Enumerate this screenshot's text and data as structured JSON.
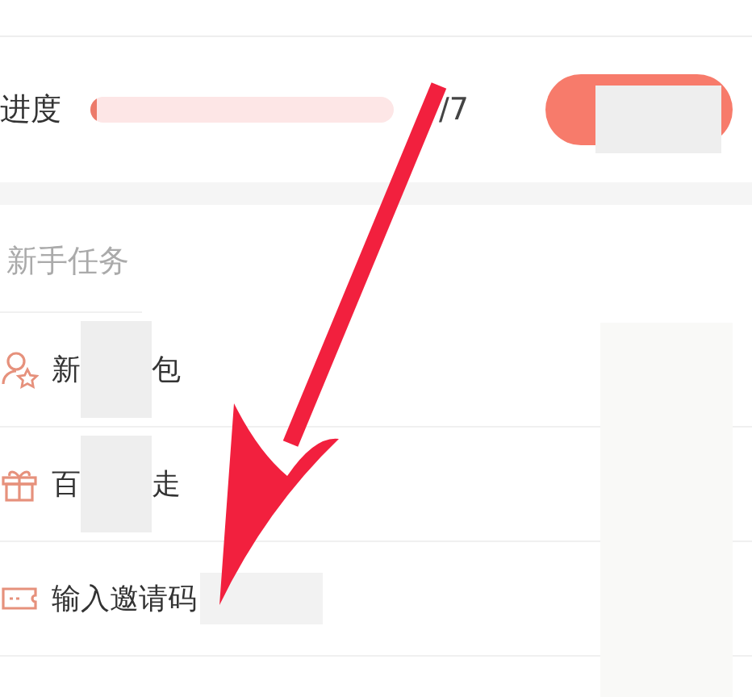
{
  "progress": {
    "label": "进度",
    "level": 0.02,
    "count": "/7"
  },
  "section": {
    "title": "新手任务"
  },
  "tasks": [
    {
      "label_start": "新",
      "label_end": "包"
    },
    {
      "label_start": "百",
      "label_end": "走"
    },
    {
      "label_start": "输入邀请码"
    }
  ]
}
